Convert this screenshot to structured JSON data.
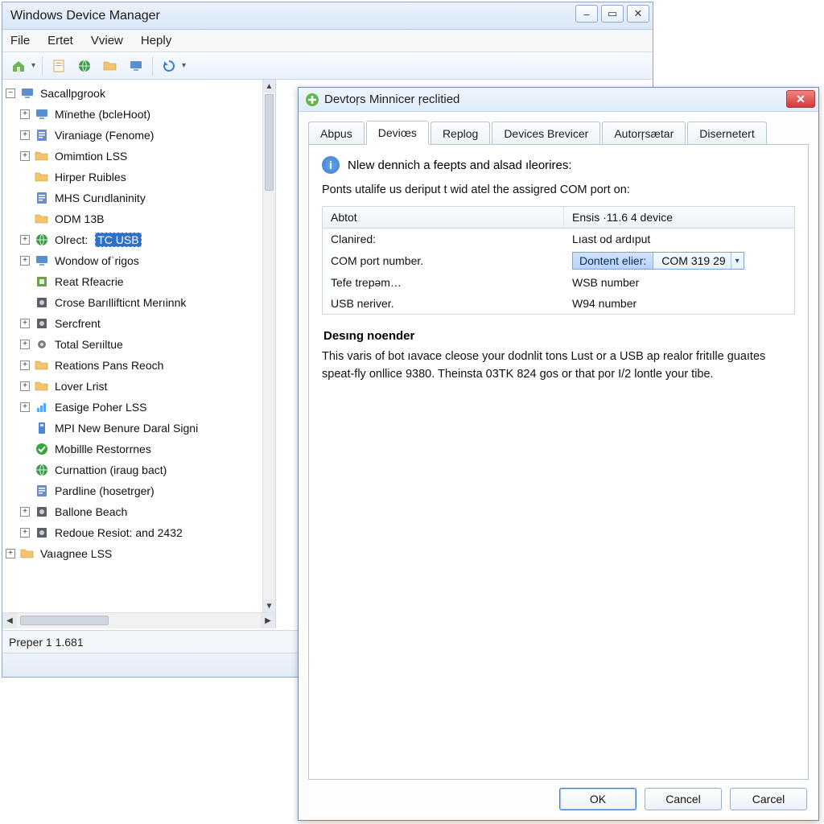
{
  "window": {
    "title": "Windows Device Manager",
    "min_label": "–",
    "max_label": "▭",
    "close_label": "✕"
  },
  "menu": {
    "file": "File",
    "edit": "Ertet",
    "view": "Vview",
    "help": "Heply"
  },
  "status": {
    "text": "Preper 1 1.681"
  },
  "tree": {
    "root": "Sacallpgrook",
    "items": [
      {
        "label": "Mïnethe (bcleHoot)",
        "exp": true,
        "icon": "monitor"
      },
      {
        "label": "Viraniage (Fenome)",
        "exp": true,
        "icon": "note"
      },
      {
        "label": "Omimtion LSS",
        "exp": true,
        "icon": "folder"
      },
      {
        "label": "Hirper Ruibles",
        "exp": false,
        "icon": "folder"
      },
      {
        "label": "MHS Curıdlaninity",
        "exp": false,
        "icon": "note"
      },
      {
        "label": "ODM 13B",
        "exp": false,
        "icon": "folder"
      },
      {
        "label": "Olrect:",
        "exp": true,
        "icon": "globe",
        "selected": true,
        "sel_suffix": "TC USB"
      },
      {
        "label": "Wondow ofˈrigos",
        "exp": true,
        "icon": "monitor"
      },
      {
        "label": "Reat Rfeacrie",
        "exp": false,
        "icon": "chip"
      },
      {
        "label": "Crose Barıllifticnt Merıinnk",
        "exp": false,
        "icon": "disk"
      },
      {
        "label": "Sercfrent",
        "exp": true,
        "icon": "disk"
      },
      {
        "label": "Total Serıiltue",
        "exp": true,
        "icon": "gear"
      },
      {
        "label": "Reations Pans Reoch",
        "exp": true,
        "icon": "folder"
      },
      {
        "label": "Lover Lrist",
        "exp": true,
        "icon": "folder"
      },
      {
        "label": "Easige Poher LSS",
        "exp": true,
        "icon": "signal"
      },
      {
        "label": "MPI New Benure Daral Signi",
        "exp": false,
        "icon": "usb"
      },
      {
        "label": "Mobillle Restorrnes",
        "exp": false,
        "icon": "check"
      },
      {
        "label": "Curnattion (iraug bact)",
        "exp": false,
        "icon": "globe"
      },
      {
        "label": "Pardline (hosetrger)",
        "exp": false,
        "icon": "note"
      },
      {
        "label": "Ballone Beach",
        "exp": true,
        "icon": "disk"
      },
      {
        "label": "Redoue Resiot: and 2432",
        "exp": true,
        "icon": "disk"
      }
    ],
    "tail": {
      "label": "Vaıagnee LSS",
      "exp": true,
      "icon": "folder"
    }
  },
  "popup": {
    "title": "Devtoŗs Minnicer ŗeclitied",
    "tabs": {
      "abpus": "Abpus",
      "devices": "Deviœs",
      "replog": "Replog",
      "brevicer": "Devices Brevicer",
      "autor": "Autorŗsætar",
      "disern": "Disernetert"
    },
    "heading": "Nlew dennich a feepts and alsad ıleorires:",
    "caption": "Ponts utalife us deriput t wid atel the assigred COM port on:",
    "columns": {
      "left": "Abtot",
      "right": "Ensis ·11.6 4 device"
    },
    "rows": [
      {
        "k": "Clanired:",
        "v": "Lıast od ardıput"
      },
      {
        "k": "COM port number.",
        "combo_left": "Dontent elier:",
        "combo_right": "COM 319 29"
      },
      {
        "k": "Tefe trepəm…",
        "v": "WSB number"
      },
      {
        "k": "USB neriver.",
        "v": "W94 number"
      }
    ],
    "section_title": "Desıng noender",
    "desc": "This varis of bot ıavace cleose your dodnlit tons Lust or a USB ap realor fritılle guaıtes speat-fly onllice 9380. Theinsta 03TK 824 gos or that por I/2 lontle your tibe.",
    "buttons": {
      "ok": "OK",
      "cancel1": "Cancel",
      "cancel2": "Carcel"
    }
  }
}
